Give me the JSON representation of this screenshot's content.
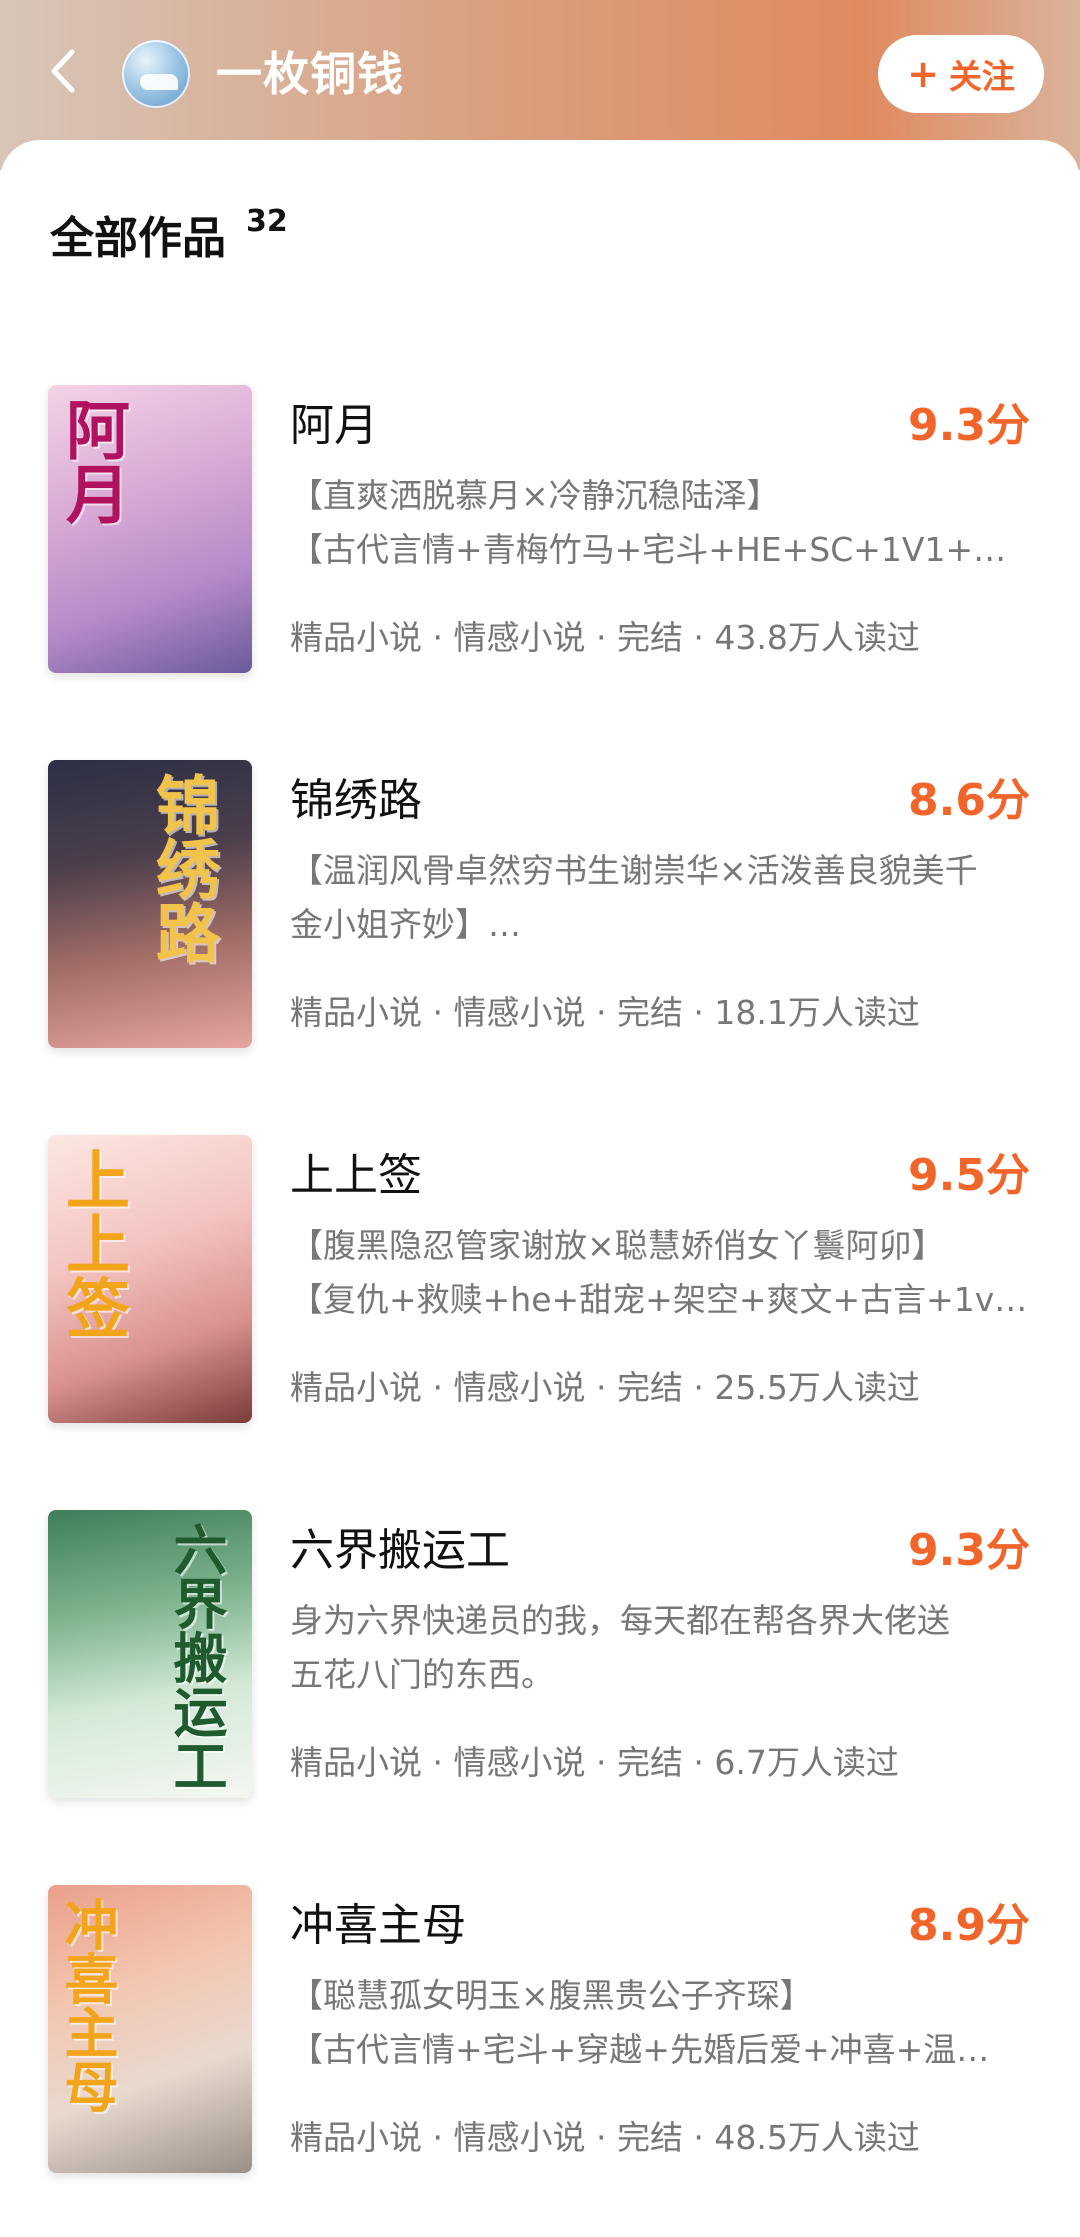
{
  "header": {
    "author_name": "一枚铜钱",
    "follow_label": "关注",
    "back_icon": "chevron-left-icon",
    "plus_icon": "plus-icon"
  },
  "section": {
    "title": "全部作品",
    "count": "32"
  },
  "colors": {
    "accent": "#f2652a",
    "header_gradient": [
      "#d8c6b9",
      "#e08a60"
    ]
  },
  "books": [
    {
      "title": "阿月",
      "score": "9.3分",
      "desc": [
        "【直爽洒脱慕月×冷静沉稳陆泽】",
        "【古代言情+青梅竹马+宅斗+HE+SC+1V1+…"
      ],
      "meta": "精品小说 · 情感小说 · 完结 · 43.8万人读过",
      "cover_text": "阿月"
    },
    {
      "title": "锦绣路",
      "score": "8.6分",
      "desc": [
        "【温润风骨卓然穷书生谢崇华×活泼善良貌美千",
        "金小姐齐妙】…"
      ],
      "meta": "精品小说 · 情感小说 · 完结 · 18.1万人读过",
      "cover_text": "锦绣路"
    },
    {
      "title": "上上签",
      "score": "9.5分",
      "desc": [
        "【腹黑隐忍管家谢放×聪慧娇俏女丫鬟阿卯】",
        "【复仇+救赎+he+甜宠+架空+爽文+古言+1v…"
      ],
      "meta": "精品小说 · 情感小说 · 完结 · 25.5万人读过",
      "cover_text": "上上签"
    },
    {
      "title": "六界搬运工",
      "score": "9.3分",
      "desc": [
        "身为六界快递员的我，每天都在帮各界大佬送",
        "五花八门的东西。"
      ],
      "meta": "精品小说 · 情感小说 · 完结 · 6.7万人读过",
      "cover_text": "六界搬运工"
    },
    {
      "title": "冲喜主母",
      "score": "8.9分",
      "desc": [
        "【聪慧孤女明玉×腹黑贵公子齐琛】",
        "【古代言情+宅斗+穿越+先婚后爱+冲喜+温…"
      ],
      "meta": "精品小说 · 情感小说 · 完结 · 48.5万人读过",
      "cover_text": "冲喜主母"
    }
  ]
}
